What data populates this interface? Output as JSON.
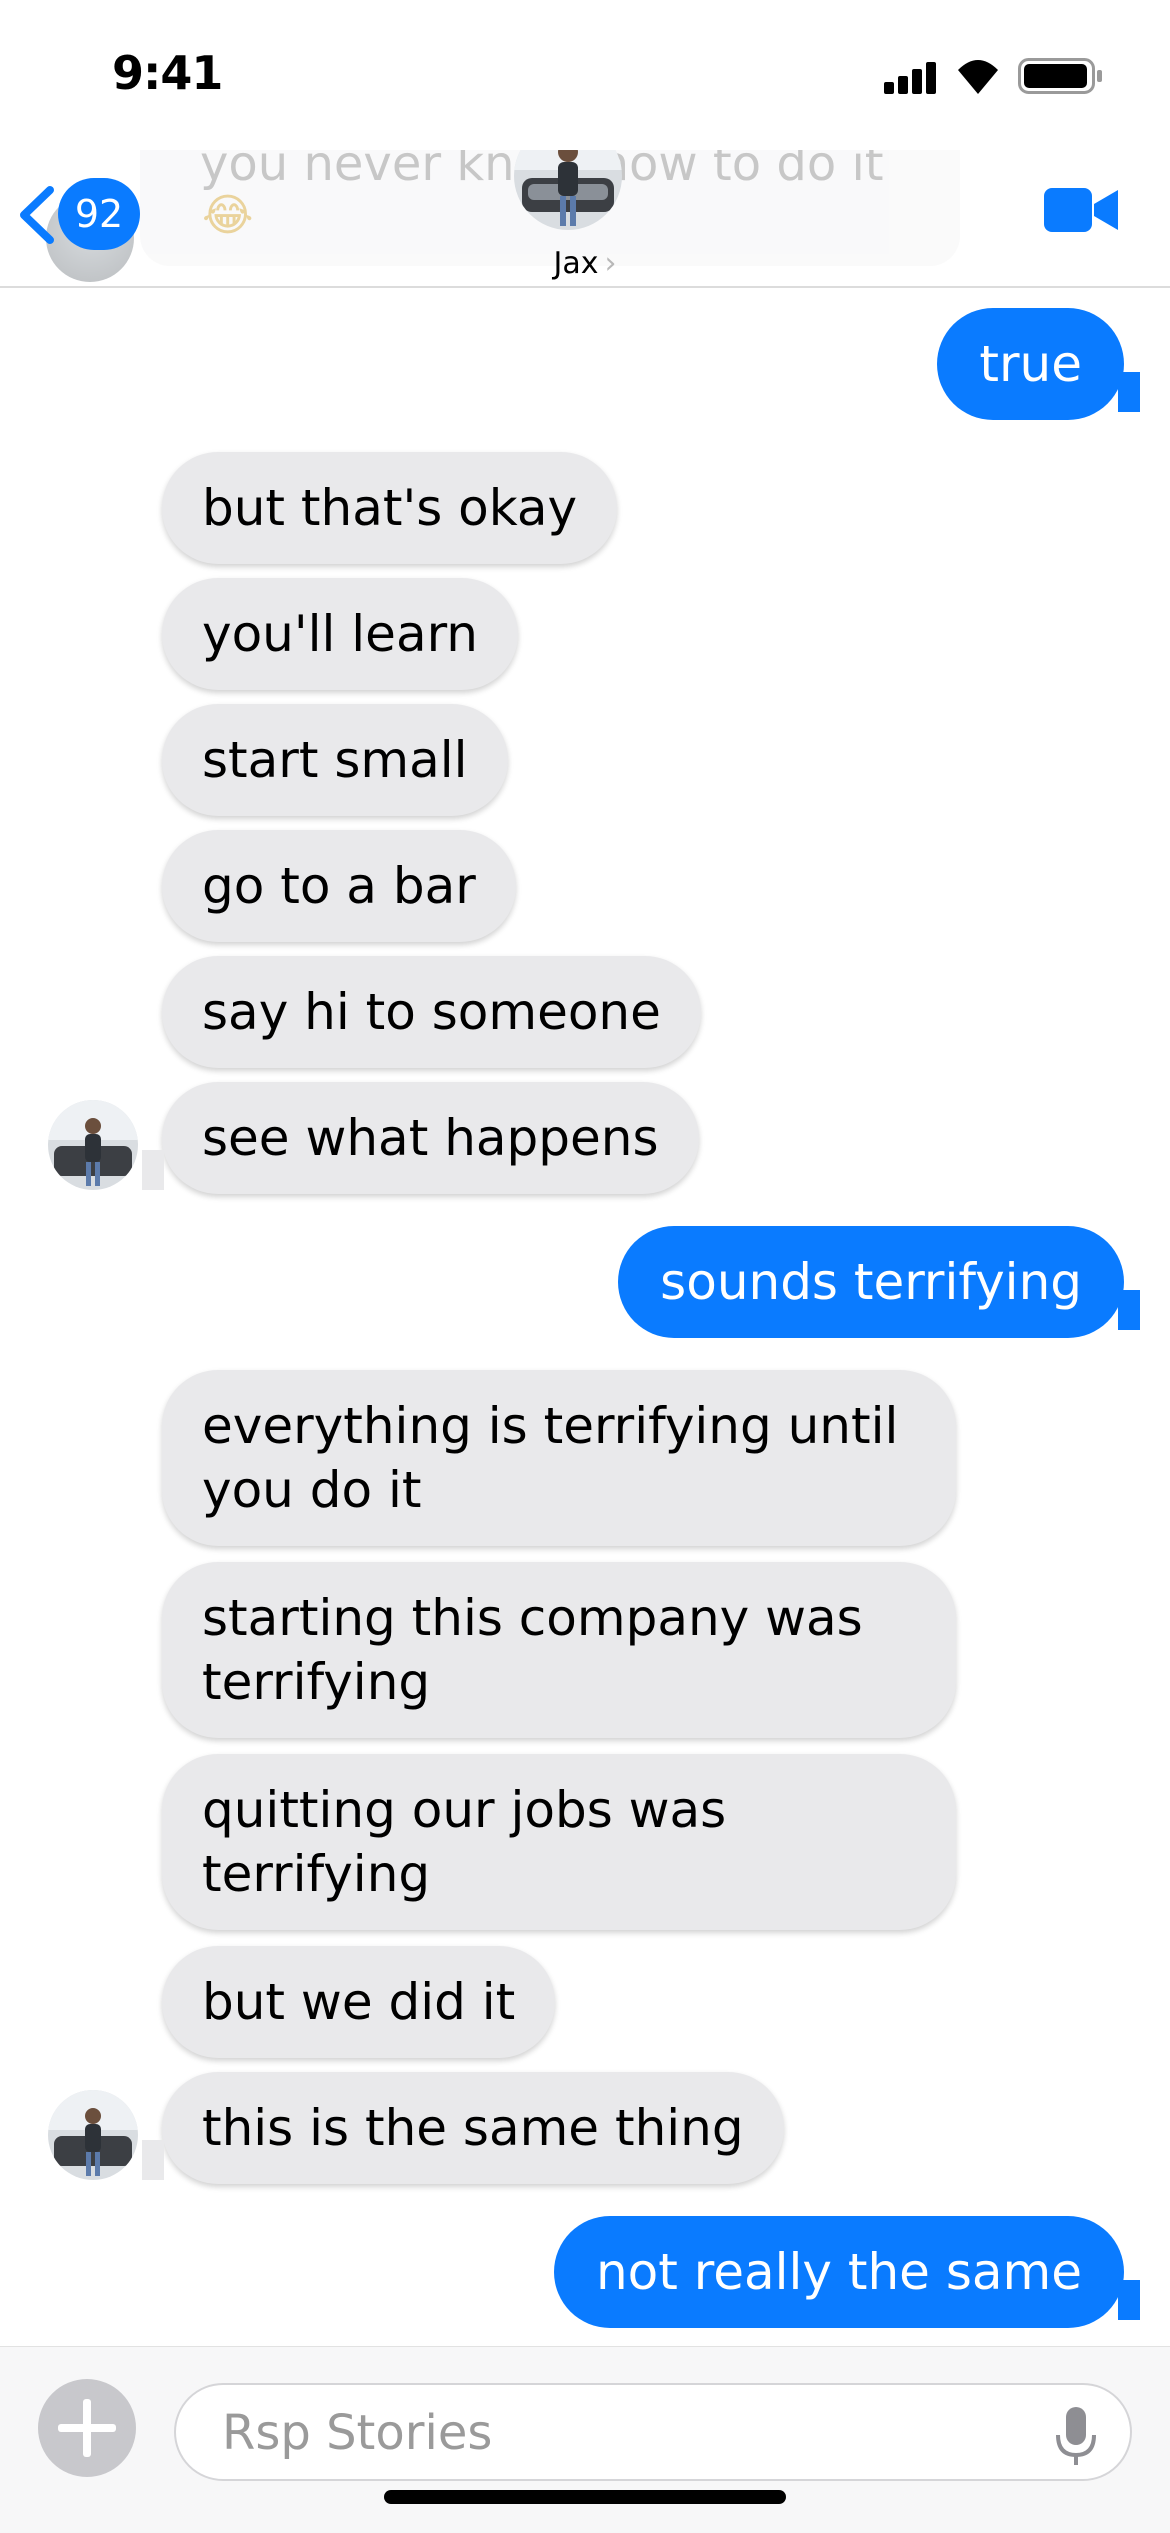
{
  "status_bar": {
    "time": "9:41"
  },
  "header": {
    "back_badge": "92",
    "contact_name": "Jax",
    "faded_prev_message": "you never knew how to do it",
    "faded_emoji": "😂"
  },
  "messages": [
    {
      "side": "out",
      "text": "true"
    },
    {
      "side": "in",
      "text": "but that's okay"
    },
    {
      "side": "in",
      "text": "you'll learn"
    },
    {
      "side": "in",
      "text": "start small"
    },
    {
      "side": "in",
      "text": "go to a bar"
    },
    {
      "side": "in",
      "text": "say hi to someone"
    },
    {
      "side": "in",
      "text": "see what happens"
    },
    {
      "side": "out",
      "text": "sounds terrifying"
    },
    {
      "side": "in",
      "text": "everything is terrifying until you do it"
    },
    {
      "side": "in",
      "text": "starting this company was terrifying"
    },
    {
      "side": "in",
      "text": "quitting our jobs was terrifying"
    },
    {
      "side": "in",
      "text": "but we did it"
    },
    {
      "side": "in",
      "text": "this is the same thing"
    },
    {
      "side": "out",
      "text": "not really the same"
    }
  ],
  "composer": {
    "placeholder": "Rsp Stories",
    "value": ""
  },
  "colors": {
    "accent": "#0a7bff",
    "incoming_bubble": "#e9e9eb"
  },
  "icons": [
    "signal-icon",
    "wifi-icon",
    "battery-icon",
    "back-chevron-icon",
    "video-call-icon",
    "add-icon",
    "microphone-icon"
  ]
}
